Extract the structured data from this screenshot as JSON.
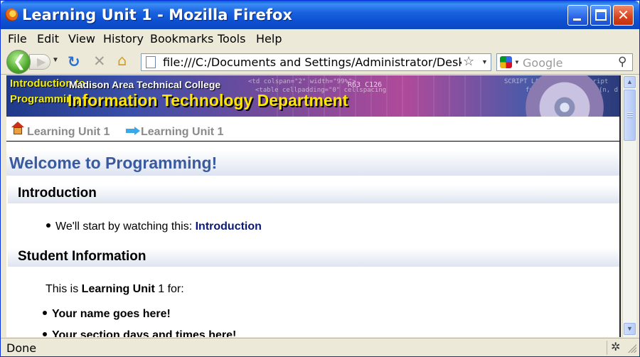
{
  "window": {
    "title": "Learning Unit 1 - Mozilla Firefox"
  },
  "menubar": {
    "items": [
      "File",
      "Edit",
      "View",
      "History",
      "Bookmarks",
      "Tools",
      "Help"
    ]
  },
  "navbar": {
    "url": "file:///C:/Documents and Settings/Administrator/Desktop/N",
    "search_placeholder": "Google"
  },
  "banner": {
    "course_title": "Introduction to Programming",
    "college": "Madison Area Technical College",
    "department": "Information Technology Department"
  },
  "breadcrumb": {
    "items": [
      "Learning Unit 1",
      "Learning Unit 1"
    ]
  },
  "page": {
    "heading": "Welcome to Programming!",
    "introduction": {
      "heading": "Introduction",
      "bullet_prefix": "We'll start by watching this: ",
      "bullet_link": "Introduction"
    },
    "student_info": {
      "heading": "Student Information",
      "intro_prefix": "This is ",
      "intro_bold": "Learning Unit",
      "intro_suffix": " 1 for:",
      "bullets": [
        "Your name goes here!",
        "Your section days and times here!"
      ]
    }
  },
  "statusbar": {
    "text": "Done"
  },
  "colors": {
    "titlebar": "#0c4fd0",
    "heading_blue": "#3a5aa0",
    "link": "#0a1a7a",
    "banner_yellow": "#ffe600"
  }
}
